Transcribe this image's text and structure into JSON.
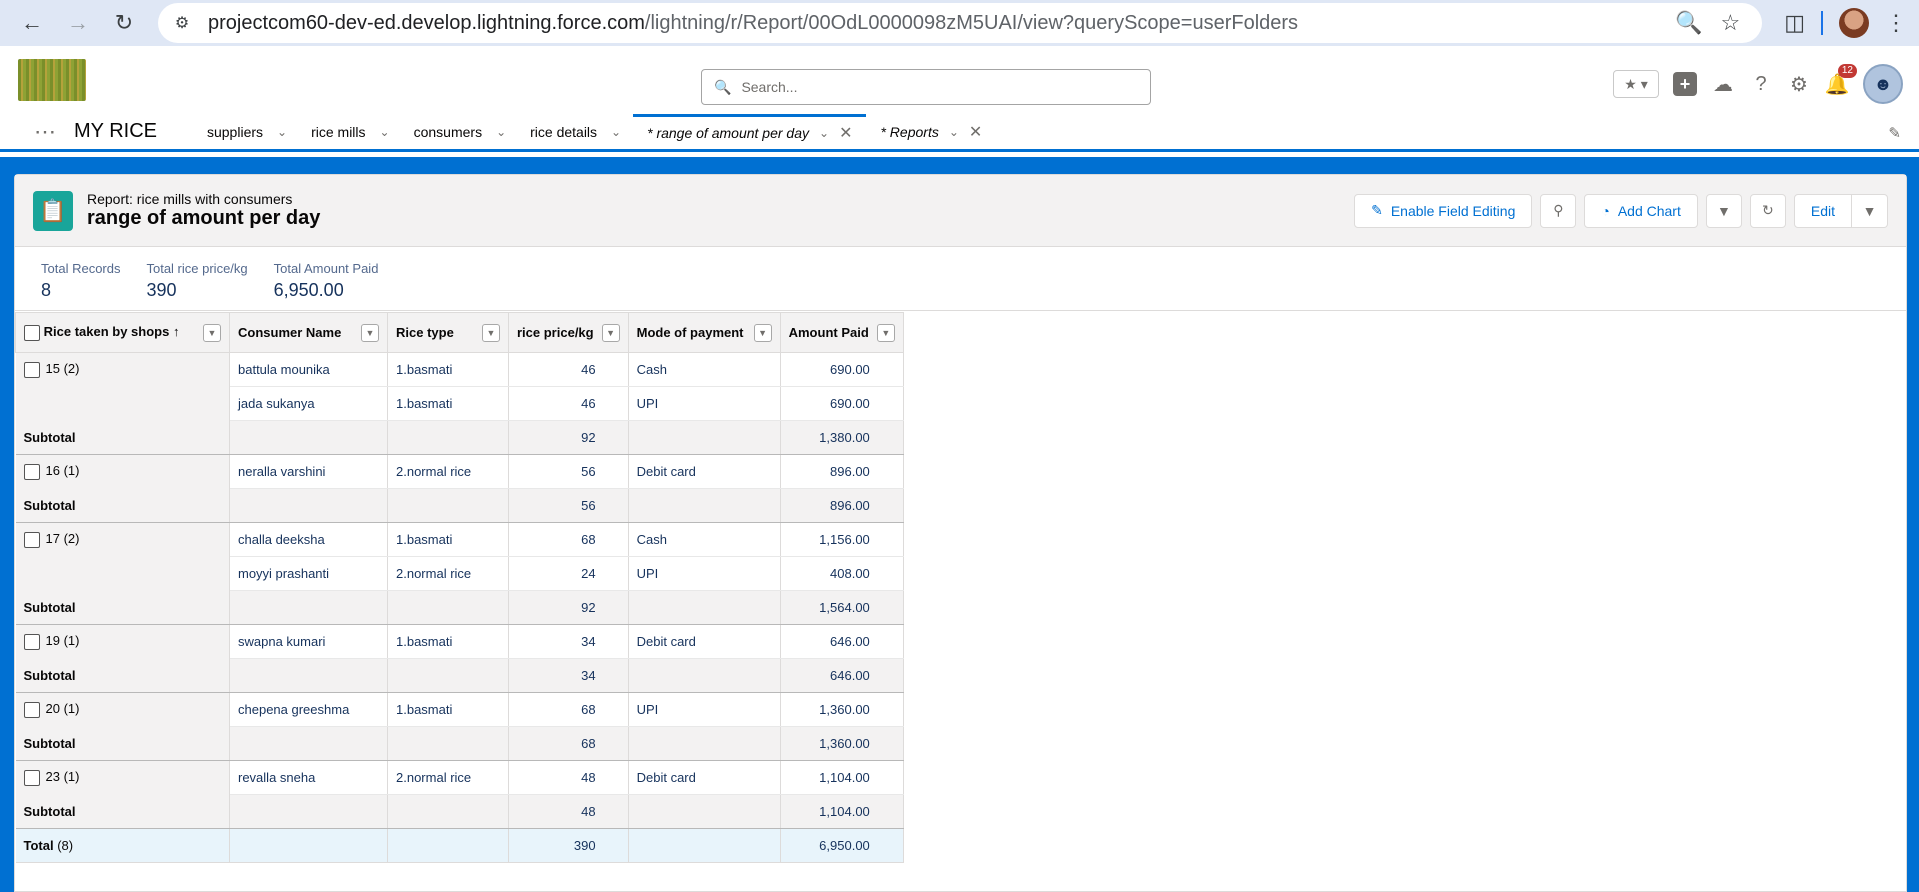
{
  "browser": {
    "url_host": "projectcom60-dev-ed.develop.lightning.force.com",
    "url_path": "/lightning/r/Report/00OdL0000098zM5UAI/view?queryScope=userFolders"
  },
  "header": {
    "search_placeholder": "Search...",
    "notification_count": "12"
  },
  "nav": {
    "app_name": "MY RICE",
    "items": [
      {
        "label": "suppliers"
      },
      {
        "label": "rice mills"
      },
      {
        "label": "consumers"
      },
      {
        "label": "rice details"
      }
    ],
    "tabs": [
      {
        "label": "* range of amount per day",
        "active": true
      },
      {
        "label": "* Reports",
        "active": false
      }
    ]
  },
  "report": {
    "subtitle": "Report: rice mills with consumers",
    "title": "range of amount per day",
    "actions": {
      "enable_field_editing": "Enable Field Editing",
      "add_chart": "Add Chart",
      "edit": "Edit"
    },
    "summary": [
      {
        "label": "Total Records",
        "value": "8"
      },
      {
        "label": "Total rice price/kg",
        "value": "390"
      },
      {
        "label": "Total Amount Paid",
        "value": "6,950.00"
      }
    ],
    "columns": [
      "Rice taken by shops",
      "Consumer Name",
      "Rice type",
      "rice price/kg",
      "Mode of payment",
      "Amount Paid"
    ],
    "sort_indicator": "↑",
    "groups": [
      {
        "group": "15 (2)",
        "rows": [
          [
            "battula mounika",
            "1.basmati",
            "46",
            "Cash",
            "690.00"
          ],
          [
            "jada sukanya",
            "1.basmati",
            "46",
            "UPI",
            "690.00"
          ]
        ],
        "subtotal_price": "92",
        "subtotal_amount": "1,380.00"
      },
      {
        "group": "16 (1)",
        "rows": [
          [
            "neralla varshini",
            "2.normal rice",
            "56",
            "Debit card",
            "896.00"
          ]
        ],
        "subtotal_price": "56",
        "subtotal_amount": "896.00"
      },
      {
        "group": "17 (2)",
        "rows": [
          [
            "challa deeksha",
            "1.basmati",
            "68",
            "Cash",
            "1,156.00"
          ],
          [
            "moyyi prashanti",
            "2.normal rice",
            "24",
            "UPI",
            "408.00"
          ]
        ],
        "subtotal_price": "92",
        "subtotal_amount": "1,564.00"
      },
      {
        "group": "19 (1)",
        "rows": [
          [
            "swapna kumari",
            "1.basmati",
            "34",
            "Debit card",
            "646.00"
          ]
        ],
        "subtotal_price": "34",
        "subtotal_amount": "646.00"
      },
      {
        "group": "20 (1)",
        "rows": [
          [
            "chepena greeshma",
            "1.basmati",
            "68",
            "UPI",
            "1,360.00"
          ]
        ],
        "subtotal_price": "68",
        "subtotal_amount": "1,360.00"
      },
      {
        "group": "23 (1)",
        "rows": [
          [
            "revalla sneha",
            "2.normal rice",
            "48",
            "Debit card",
            "1,104.00"
          ]
        ],
        "subtotal_price": "48",
        "subtotal_amount": "1,104.00"
      }
    ],
    "subtotal_label": "Subtotal",
    "total_label": "Total",
    "total_count": "(8)",
    "total_price": "390",
    "total_amount": "6,950.00"
  }
}
